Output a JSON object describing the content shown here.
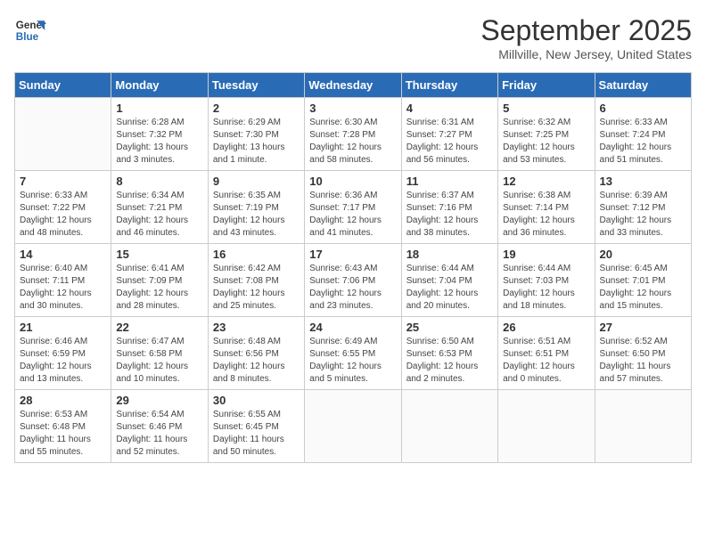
{
  "logo": {
    "general": "General",
    "blue": "Blue"
  },
  "title": "September 2025",
  "subtitle": "Millville, New Jersey, United States",
  "days_of_week": [
    "Sunday",
    "Monday",
    "Tuesday",
    "Wednesday",
    "Thursday",
    "Friday",
    "Saturday"
  ],
  "weeks": [
    [
      {
        "day": "",
        "info": ""
      },
      {
        "day": "1",
        "info": "Sunrise: 6:28 AM\nSunset: 7:32 PM\nDaylight: 13 hours\nand 3 minutes."
      },
      {
        "day": "2",
        "info": "Sunrise: 6:29 AM\nSunset: 7:30 PM\nDaylight: 13 hours\nand 1 minute."
      },
      {
        "day": "3",
        "info": "Sunrise: 6:30 AM\nSunset: 7:28 PM\nDaylight: 12 hours\nand 58 minutes."
      },
      {
        "day": "4",
        "info": "Sunrise: 6:31 AM\nSunset: 7:27 PM\nDaylight: 12 hours\nand 56 minutes."
      },
      {
        "day": "5",
        "info": "Sunrise: 6:32 AM\nSunset: 7:25 PM\nDaylight: 12 hours\nand 53 minutes."
      },
      {
        "day": "6",
        "info": "Sunrise: 6:33 AM\nSunset: 7:24 PM\nDaylight: 12 hours\nand 51 minutes."
      }
    ],
    [
      {
        "day": "7",
        "info": "Sunrise: 6:33 AM\nSunset: 7:22 PM\nDaylight: 12 hours\nand 48 minutes."
      },
      {
        "day": "8",
        "info": "Sunrise: 6:34 AM\nSunset: 7:21 PM\nDaylight: 12 hours\nand 46 minutes."
      },
      {
        "day": "9",
        "info": "Sunrise: 6:35 AM\nSunset: 7:19 PM\nDaylight: 12 hours\nand 43 minutes."
      },
      {
        "day": "10",
        "info": "Sunrise: 6:36 AM\nSunset: 7:17 PM\nDaylight: 12 hours\nand 41 minutes."
      },
      {
        "day": "11",
        "info": "Sunrise: 6:37 AM\nSunset: 7:16 PM\nDaylight: 12 hours\nand 38 minutes."
      },
      {
        "day": "12",
        "info": "Sunrise: 6:38 AM\nSunset: 7:14 PM\nDaylight: 12 hours\nand 36 minutes."
      },
      {
        "day": "13",
        "info": "Sunrise: 6:39 AM\nSunset: 7:12 PM\nDaylight: 12 hours\nand 33 minutes."
      }
    ],
    [
      {
        "day": "14",
        "info": "Sunrise: 6:40 AM\nSunset: 7:11 PM\nDaylight: 12 hours\nand 30 minutes."
      },
      {
        "day": "15",
        "info": "Sunrise: 6:41 AM\nSunset: 7:09 PM\nDaylight: 12 hours\nand 28 minutes."
      },
      {
        "day": "16",
        "info": "Sunrise: 6:42 AM\nSunset: 7:08 PM\nDaylight: 12 hours\nand 25 minutes."
      },
      {
        "day": "17",
        "info": "Sunrise: 6:43 AM\nSunset: 7:06 PM\nDaylight: 12 hours\nand 23 minutes."
      },
      {
        "day": "18",
        "info": "Sunrise: 6:44 AM\nSunset: 7:04 PM\nDaylight: 12 hours\nand 20 minutes."
      },
      {
        "day": "19",
        "info": "Sunrise: 6:44 AM\nSunset: 7:03 PM\nDaylight: 12 hours\nand 18 minutes."
      },
      {
        "day": "20",
        "info": "Sunrise: 6:45 AM\nSunset: 7:01 PM\nDaylight: 12 hours\nand 15 minutes."
      }
    ],
    [
      {
        "day": "21",
        "info": "Sunrise: 6:46 AM\nSunset: 6:59 PM\nDaylight: 12 hours\nand 13 minutes."
      },
      {
        "day": "22",
        "info": "Sunrise: 6:47 AM\nSunset: 6:58 PM\nDaylight: 12 hours\nand 10 minutes."
      },
      {
        "day": "23",
        "info": "Sunrise: 6:48 AM\nSunset: 6:56 PM\nDaylight: 12 hours\nand 8 minutes."
      },
      {
        "day": "24",
        "info": "Sunrise: 6:49 AM\nSunset: 6:55 PM\nDaylight: 12 hours\nand 5 minutes."
      },
      {
        "day": "25",
        "info": "Sunrise: 6:50 AM\nSunset: 6:53 PM\nDaylight: 12 hours\nand 2 minutes."
      },
      {
        "day": "26",
        "info": "Sunrise: 6:51 AM\nSunset: 6:51 PM\nDaylight: 12 hours\nand 0 minutes."
      },
      {
        "day": "27",
        "info": "Sunrise: 6:52 AM\nSunset: 6:50 PM\nDaylight: 11 hours\nand 57 minutes."
      }
    ],
    [
      {
        "day": "28",
        "info": "Sunrise: 6:53 AM\nSunset: 6:48 PM\nDaylight: 11 hours\nand 55 minutes."
      },
      {
        "day": "29",
        "info": "Sunrise: 6:54 AM\nSunset: 6:46 PM\nDaylight: 11 hours\nand 52 minutes."
      },
      {
        "day": "30",
        "info": "Sunrise: 6:55 AM\nSunset: 6:45 PM\nDaylight: 11 hours\nand 50 minutes."
      },
      {
        "day": "",
        "info": ""
      },
      {
        "day": "",
        "info": ""
      },
      {
        "day": "",
        "info": ""
      },
      {
        "day": "",
        "info": ""
      }
    ]
  ]
}
